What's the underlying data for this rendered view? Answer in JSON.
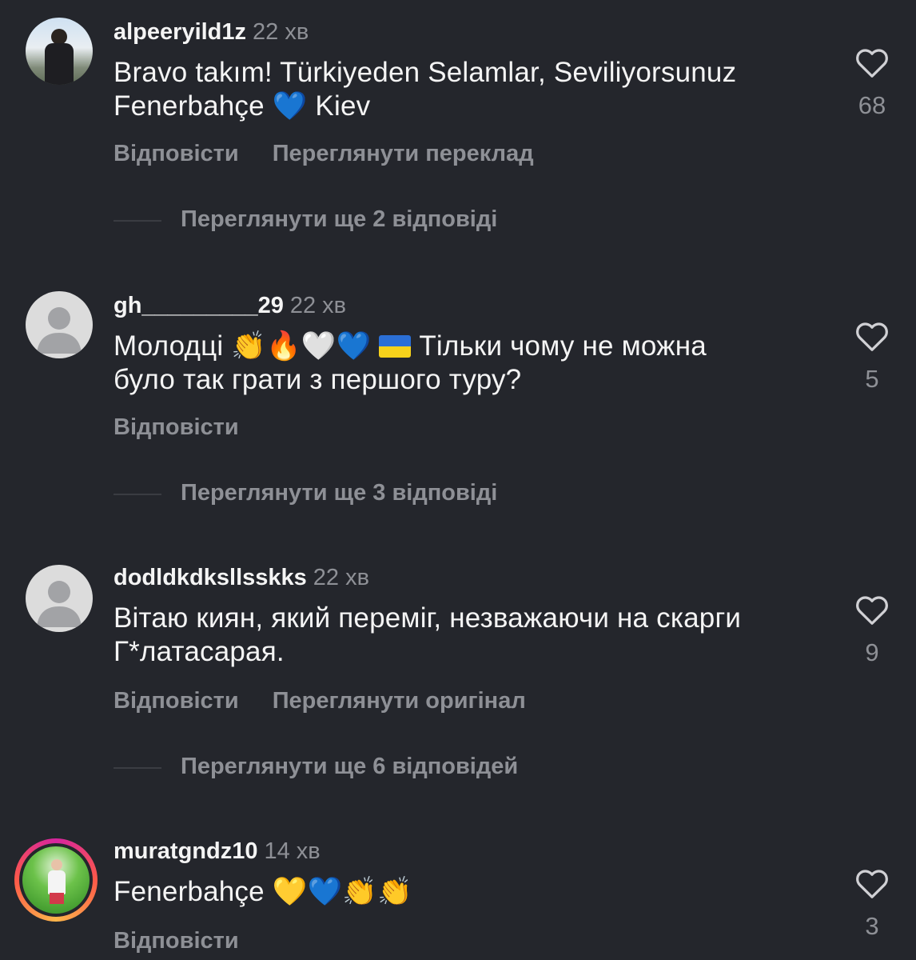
{
  "comments": [
    {
      "username": "alpeeryild1z",
      "time": "22 хв",
      "text_line1": "Bravo takım! Türkiyeden Selamlar, Seviliyorsunuz",
      "text_line2_pre": "Fenerbahçe ",
      "text_line2_emoji": "💙",
      "text_line2_post": " Kiev",
      "reply": "Відповісти",
      "secondary_action": "Переглянути переклад",
      "likes": "68",
      "more_replies": "Переглянути ще 2 відповіді"
    },
    {
      "username": "gh_________29",
      "time": "22 хв",
      "text_line1_pre": "Молодці ",
      "text_line1_emojis": "👏🔥🤍💙",
      "text_line1_post": " Тільки чому не можна",
      "text_line2": "було так грати з першого туру?",
      "reply": "Відповісти",
      "likes": "5",
      "more_replies": "Переглянути ще 3 відповіді"
    },
    {
      "username": "dodldkdksllsskks",
      "time": "22 хв",
      "text_line1": "Вітаю киян, який переміг, незважаючи на скарги",
      "text_line2": "Г*латасарая.",
      "reply": "Відповісти",
      "secondary_action": "Переглянути оригінал",
      "likes": "9",
      "more_replies": "Переглянути ще 6 відповідей"
    },
    {
      "username": "muratgndz10",
      "time": "14 хв",
      "text_pre": "Fenerbahçe ",
      "text_emojis": "💛💙👏👏",
      "reply": "Відповісти",
      "likes": "3"
    }
  ],
  "icons": {
    "heart": "heart-outline-icon",
    "default_avatar": "default-avatar-icon"
  },
  "colors": {
    "background": "#24262c",
    "text_primary": "#f4f4f4",
    "text_secondary": "#8e9096",
    "story_ring": "#d6249f"
  }
}
